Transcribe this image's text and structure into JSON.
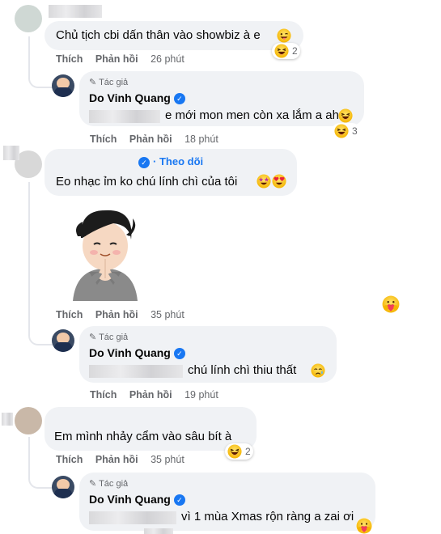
{
  "comments": [
    {
      "text": "Chủ tịch cbi dấn thân vào showbiz à e",
      "actions": {
        "like": "Thích",
        "reply": "Phản hồi",
        "time": "26 phút"
      },
      "reaction_count": "2"
    },
    {
      "text": "Eo nhạc ỉm ko chú lính chì của tôi",
      "follow": "Theo dõi",
      "actions": {
        "like": "Thích",
        "reply": "Phản hồi",
        "time": "35 phút"
      }
    },
    {
      "text": "Em mình nhảy cẩm vào sâu bít à",
      "actions": {
        "like": "Thích",
        "reply": "Phản hồi",
        "time": "35 phút"
      },
      "reaction_count": "2"
    }
  ],
  "replies": [
    {
      "badge": "Tác giả",
      "name": "Do Vinh Quang",
      "text": "e mới mon men còn xa lắm a ah",
      "actions": {
        "like": "Thích",
        "reply": "Phản hồi",
        "time": "18 phút"
      },
      "reaction_count": "3"
    },
    {
      "badge": "Tác giả",
      "name": "Do Vinh Quang",
      "text": "chú lính chì thiu thất",
      "actions": {
        "like": "Thích",
        "reply": "Phản hồi",
        "time": "19 phút"
      }
    },
    {
      "badge": "Tác giả",
      "name": "Do Vinh Quang",
      "text": "vì 1 mùa Xmas rộn ràng a zai ơi"
    }
  ],
  "icons": {
    "laugh": "laughing-emoji",
    "star_eyes": "star-struck-emoji",
    "heart_eyes": "heart-eyes-emoji",
    "care": "care-reaction",
    "verified": "verified-badge"
  },
  "colors": {
    "bubble": "#f0f2f5",
    "secondary_text": "#65676b",
    "link": "#1877f2"
  }
}
